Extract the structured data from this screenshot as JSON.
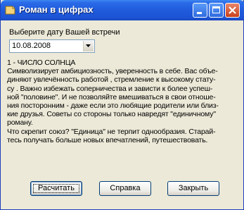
{
  "window": {
    "title": "Роман в цифрах",
    "buttons": {
      "minimize": "minimize",
      "maximize": "maximize",
      "close": "close"
    }
  },
  "date_prompt": "Выберите дату Вашей встречи",
  "date_field": {
    "value": "10.08.2008"
  },
  "result": {
    "lines": [
      "1 - ЧИСЛО СОЛНЦА",
      "Символизирует амбициозность, уверенность в себе. Вас объе-",
      "диняют увлечённость работой , стремление к  высокому стату-",
      "су . Важно избежать соперничества и зависти  к  более успеш-",
      "ной \"половине\". И не позволяйте вмешиваться в свои отноше-",
      "ния посторонним - даже если это любящие родители или близ-",
      "кие друзья. Советы со стороны только навредят \"единичному\"",
      "роману.",
      "Что скрепит союз? \"Единица\" не терпит однообразия. Старай-",
      "тесь получать больше новых впечатлений, путешествовать."
    ]
  },
  "buttons": {
    "calculate": "Расчитать",
    "help": "Справка",
    "close": "Закрыть"
  },
  "colors": {
    "title_bar": "#1f5bdc",
    "window_face": "#ece9d8",
    "close_button": "#d5522c"
  }
}
